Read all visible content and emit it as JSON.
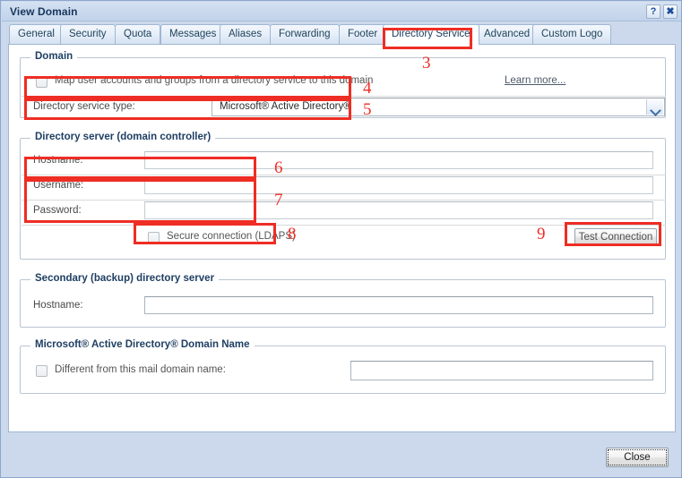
{
  "window": {
    "title": "View Domain",
    "help_button": "?",
    "close_button_glyph": "✖"
  },
  "tabs": [
    {
      "label": "General",
      "active": false
    },
    {
      "label": "Security",
      "active": false
    },
    {
      "label": "Quota",
      "active": false
    },
    {
      "label": "Messages",
      "active": false
    },
    {
      "label": "Aliases",
      "active": false
    },
    {
      "label": "Forwarding",
      "active": false
    },
    {
      "label": "Footer",
      "active": false
    },
    {
      "label": "Directory Service",
      "active": true
    },
    {
      "label": "Advanced",
      "active": false
    },
    {
      "label": "Custom Logo",
      "active": false
    }
  ],
  "sections": {
    "domain": {
      "legend": "Domain",
      "map_checkbox_label": "Map user accounts and groups from a directory service to this domain",
      "map_checkbox_checked": false,
      "learn_more_label": "Learn more...",
      "service_type_label": "Directory service type:",
      "service_type_value": "Microsoft® Active Directory®"
    },
    "directory_server": {
      "legend": "Directory server (domain controller)",
      "hostname_label": "Hostname:",
      "hostname_value": "",
      "username_label": "Username:",
      "username_value": "",
      "password_label": "Password:",
      "password_value": "",
      "secure_checkbox_label": "Secure connection (LDAPS)",
      "secure_checkbox_checked": false,
      "test_connection_label": "Test Connection"
    },
    "secondary_server": {
      "legend": "Secondary (backup) directory server",
      "hostname_label": "Hostname:",
      "hostname_value": ""
    },
    "ad_domain_name": {
      "legend": "Microsoft® Active Directory® Domain Name",
      "different_checkbox_label": "Different from this mail domain name:",
      "different_checkbox_checked": false,
      "domain_name_value": ""
    }
  },
  "footer": {
    "close_label": "Close"
  },
  "annotations": [
    {
      "number": "3"
    },
    {
      "number": "4"
    },
    {
      "number": "5"
    },
    {
      "number": "6"
    },
    {
      "number": "7"
    },
    {
      "number": "8"
    },
    {
      "number": "9"
    }
  ],
  "colors": {
    "annotation_red": "#ee2d24",
    "chrome_blue": "#ccd9ec",
    "legend_navy": "#1f3f63",
    "title_navy": "#17365d"
  }
}
